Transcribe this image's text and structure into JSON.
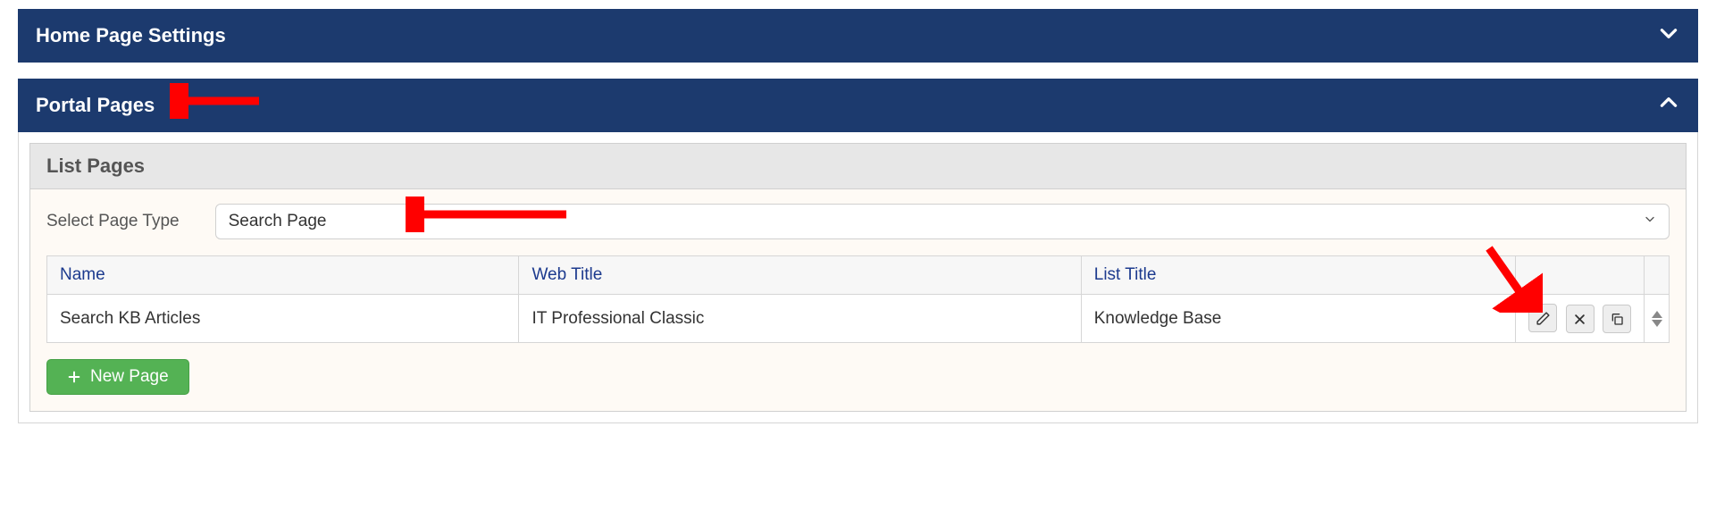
{
  "panels": {
    "home_page_settings": {
      "title": "Home Page Settings",
      "expanded": false
    },
    "portal_pages": {
      "title": "Portal Pages",
      "expanded": true
    }
  },
  "list_pages": {
    "title": "List Pages",
    "select_label": "Select Page Type",
    "selected_value": "Search Page",
    "columns": {
      "name": "Name",
      "web_title": "Web Title",
      "list_title": "List Title"
    },
    "rows": [
      {
        "name": "Search KB Articles",
        "web_title": "IT Professional Classic",
        "list_title": "Knowledge Base"
      }
    ],
    "new_page_label": "New Page"
  }
}
